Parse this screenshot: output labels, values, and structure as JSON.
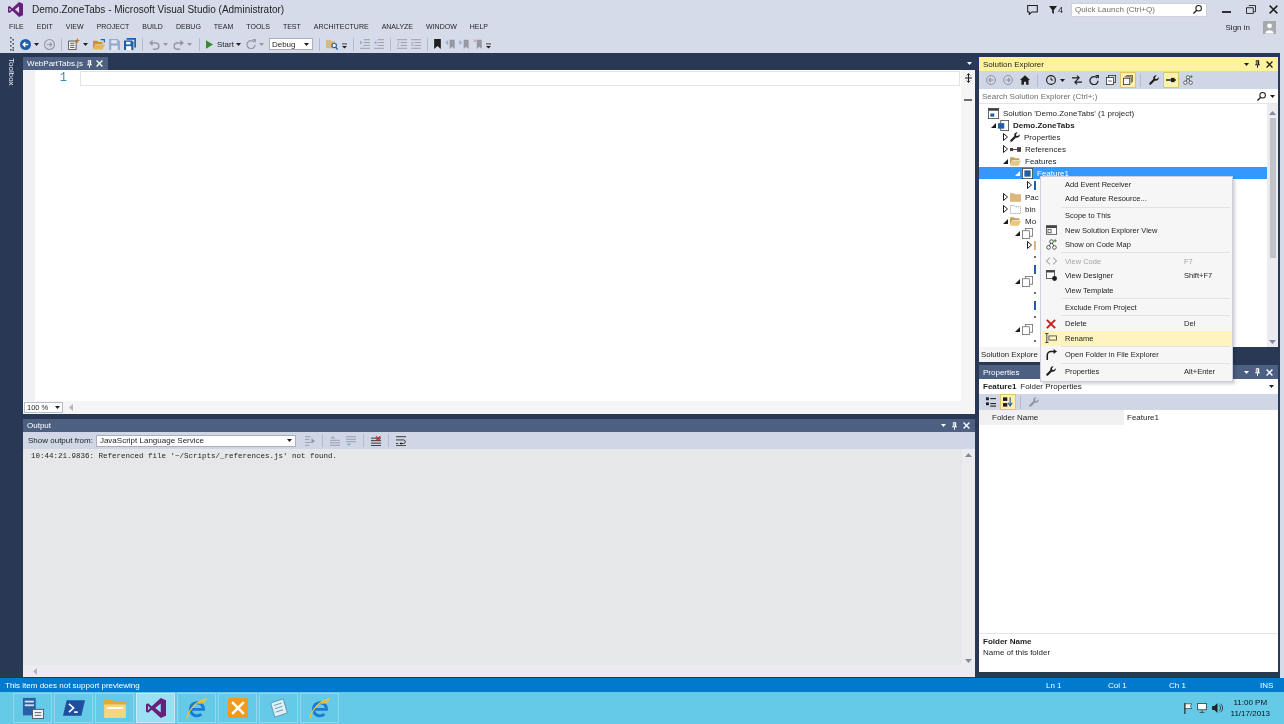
{
  "window": {
    "title": "Demo.ZoneTabs - Microsoft Visual Studio (Administrator)",
    "notification_count": "4",
    "quick_launch": {
      "placeholder": "Quick Launch (Ctrl+Q)"
    },
    "sign_in": "Sign in"
  },
  "menu_bar": [
    "FILE",
    "EDIT",
    "VIEW",
    "PROJECT",
    "BUILD",
    "DEBUG",
    "TEAM",
    "TOOLS",
    "TEST",
    "ARCHITECTURE",
    "ANALYZE",
    "WINDOW",
    "HELP"
  ],
  "toolbar": {
    "groups": [
      [
        {
          "kind": "button",
          "disabled": false,
          "dropdown": true
        },
        {
          "kind": "button",
          "disabled": true,
          "dropdown": false
        }
      ],
      [
        {
          "kind": "button",
          "disabled": false,
          "dropdown": true
        },
        {
          "kind": "button",
          "disabled": false,
          "dropdown": false
        },
        {
          "kind": "button",
          "disabled": true,
          "dropdown": false
        },
        {
          "kind": "button",
          "disabled": false,
          "dropdown": false
        }
      ],
      [
        {
          "kind": "button",
          "disabled": true,
          "dropdown": true
        },
        {
          "kind": "button",
          "disabled": true,
          "dropdown": true
        }
      ],
      [
        {
          "kind": "button",
          "label": "Start",
          "disabled": false,
          "dropdown": true
        },
        {
          "kind": "button",
          "disabled": true,
          "dropdown": true
        },
        {
          "kind": "combo",
          "value": "Debug",
          "disabled": false
        }
      ],
      [
        {
          "kind": "button",
          "disabled": false,
          "dropdown": false
        },
        {
          "kind": "overflow",
          "disabled": false
        }
      ],
      [
        {
          "kind": "button",
          "disabled": true,
          "dropdown": false
        },
        {
          "kind": "button",
          "disabled": true,
          "dropdown": false
        }
      ],
      [
        {
          "kind": "button",
          "disabled": true,
          "dropdown": false
        },
        {
          "kind": "button",
          "disabled": true,
          "dropdown": false
        }
      ],
      [
        {
          "kind": "button",
          "disabled": false,
          "dropdown": false
        },
        {
          "kind": "button",
          "disabled": true,
          "dropdown": false
        },
        {
          "kind": "button",
          "disabled": true,
          "dropdown": false
        },
        {
          "kind": "button",
          "disabled": true,
          "dropdown": false
        },
        {
          "kind": "overflow",
          "disabled": false
        }
      ]
    ]
  },
  "toolbox_tab": {
    "label": "Toolbox"
  },
  "editor": {
    "tabs": [
      {
        "label": "WebPartTabs.js",
        "selected": true
      }
    ],
    "line_numbers": [
      "1"
    ],
    "zoom": "100 %"
  },
  "output": {
    "title": "Output",
    "active": false,
    "source_label": "Show output from:",
    "source": "JavaScript Language Service",
    "toolbar": {
      "groups": [
        [
          {
            "disabled": true
          }
        ],
        [
          {
            "disabled": true
          },
          {
            "disabled": true
          }
        ],
        [
          {
            "disabled": false
          }
        ],
        [
          {
            "disabled": false
          }
        ]
      ]
    },
    "lines": [
      "10:44:21.9836: Referenced file '~/Scripts/_references.js' not found."
    ]
  },
  "solution_explorer": {
    "title": "Solution Explorer",
    "active": true,
    "toolbar": {
      "groups": [
        [
          {
            "disabled": true,
            "on": false,
            "dropdown": false
          },
          {
            "disabled": true,
            "on": false,
            "dropdown": false
          },
          {
            "disabled": false,
            "on": false,
            "dropdown": false
          }
        ],
        [
          {
            "disabled": false,
            "on": false,
            "dropdown": true
          },
          {
            "disabled": false,
            "on": false,
            "dropdown": false
          },
          {
            "disabled": false,
            "on": false,
            "dropdown": false
          },
          {
            "disabled": false,
            "on": false,
            "dropdown": false
          },
          {
            "disabled": false,
            "on": true,
            "dropdown": false
          }
        ],
        [
          {
            "disabled": false,
            "on": false,
            "dropdown": false
          },
          {
            "disabled": false,
            "on": true,
            "dropdown": false
          },
          {
            "disabled": false,
            "on": false,
            "dropdown": false
          }
        ]
      ]
    },
    "search": {
      "placeholder": "Search Solution Explorer (Ctrl+;)"
    },
    "tree": [
      {
        "kind": "solution",
        "label": "Solution 'Demo.ZoneTabs' (1 project)",
        "selected": false,
        "children": [
          {
            "kind": "project",
            "label": "Demo.ZoneTabs",
            "expanded": true,
            "selected": false,
            "children": [
              {
                "kind": "properties",
                "label": "Properties",
                "expanded": false,
                "selected": false
              },
              {
                "kind": "references",
                "label": "References",
                "expanded": false,
                "selected": false
              },
              {
                "kind": "folder",
                "label": "Features",
                "expanded": true,
                "selected": false,
                "children": [
                  {
                    "kind": "feature",
                    "label": "Feature1",
                    "expanded": true,
                    "selected": true,
                    "children": [
                      {
                        "kind": "xml",
                        "expanded": false,
                        "selected": false
                      }
                    ]
                  }
                ]
              },
              {
                "kind": "folder",
                "label": "Pac",
                "expanded": false,
                "selected": false
              },
              {
                "kind": "excluded",
                "label": "bin",
                "expanded": false,
                "selected": false
              },
              {
                "kind": "folder",
                "label": "Mo",
                "expanded": true,
                "selected": false,
                "children": [
                  {
                    "kind": "module",
                    "expanded": true,
                    "selected": false,
                    "children": [
                      {
                        "kind": "folder",
                        "expanded": false,
                        "selected": false
                      },
                      {
                        "kind": "file",
                        "selected": false
                      },
                      {
                        "kind": "xml",
                        "selected": false
                      }
                    ]
                  },
                  {
                    "kind": "module",
                    "expanded": true,
                    "selected": false,
                    "children": [
                      {
                        "kind": "file",
                        "selected": false
                      },
                      {
                        "kind": "xml",
                        "selected": false
                      },
                      {
                        "kind": "file",
                        "selected": false
                      }
                    ]
                  },
                  {
                    "kind": "module",
                    "expanded": true,
                    "selected": false,
                    "children": [
                      {
                        "kind": "file",
                        "selected": false
                      }
                    ]
                  }
                ]
              }
            ]
          }
        ]
      }
    ],
    "tabs": [
      {
        "label": "Solution Explore",
        "selected": true
      }
    ]
  },
  "context_menu": {
    "groups": [
      [
        {
          "label": "Add Event Receiver",
          "disabled": false,
          "selected": false
        },
        {
          "label": "Add Feature Resource...",
          "disabled": false,
          "selected": false
        }
      ],
      [
        {
          "label": "Scope to This",
          "disabled": false,
          "selected": false
        },
        {
          "label": "New Solution Explorer View",
          "disabled": false,
          "selected": false
        },
        {
          "label": "Show on Code Map",
          "disabled": false,
          "selected": false
        }
      ],
      [
        {
          "label": "View Code",
          "shortcut": "F7",
          "disabled": true,
          "selected": false
        },
        {
          "label": "View Designer",
          "shortcut": "Shift+F7",
          "disabled": false,
          "selected": false
        },
        {
          "label": "View Template",
          "disabled": false,
          "selected": false
        }
      ],
      [
        {
          "label": "Exclude From Project",
          "disabled": false,
          "selected": false
        }
      ],
      [
        {
          "label": "Delete",
          "shortcut": "Del",
          "disabled": false,
          "selected": false
        },
        {
          "label": "Rename",
          "disabled": false,
          "selected": true
        }
      ],
      [
        {
          "label": "Open Folder in File Explorer",
          "disabled": false,
          "selected": false
        }
      ],
      [
        {
          "label": "Properties",
          "shortcut": "Alt+Enter",
          "disabled": false,
          "selected": false
        }
      ]
    ]
  },
  "properties": {
    "title": "Properties",
    "active": false,
    "object_name": "Feature1",
    "object_type": "Folder Properties",
    "toolbar": {
      "groups": [
        [
          {
            "disabled": false,
            "on": false
          },
          {
            "disabled": false,
            "on": true
          }
        ],
        [
          {
            "disabled": true,
            "on": false
          }
        ]
      ]
    },
    "rows": [
      {
        "name": "Folder Name",
        "value": "Feature1"
      }
    ],
    "description": {
      "title": "Folder Name",
      "text": "Name of this folder"
    }
  },
  "status_bar": {
    "message": "This item does not support previewing",
    "line": "Ln 1",
    "column": "Col 1",
    "char": "Ch 1",
    "mode": "INS"
  },
  "taskbar": {
    "apps": [
      {
        "selected": false
      },
      {
        "selected": false
      },
      {
        "selected": false
      },
      {
        "selected": true
      },
      {
        "selected": false
      },
      {
        "selected": false
      },
      {
        "selected": false
      },
      {
        "selected": false
      }
    ],
    "tray": {
      "time": "11:00 PM",
      "date": "11/17/2013"
    }
  }
}
